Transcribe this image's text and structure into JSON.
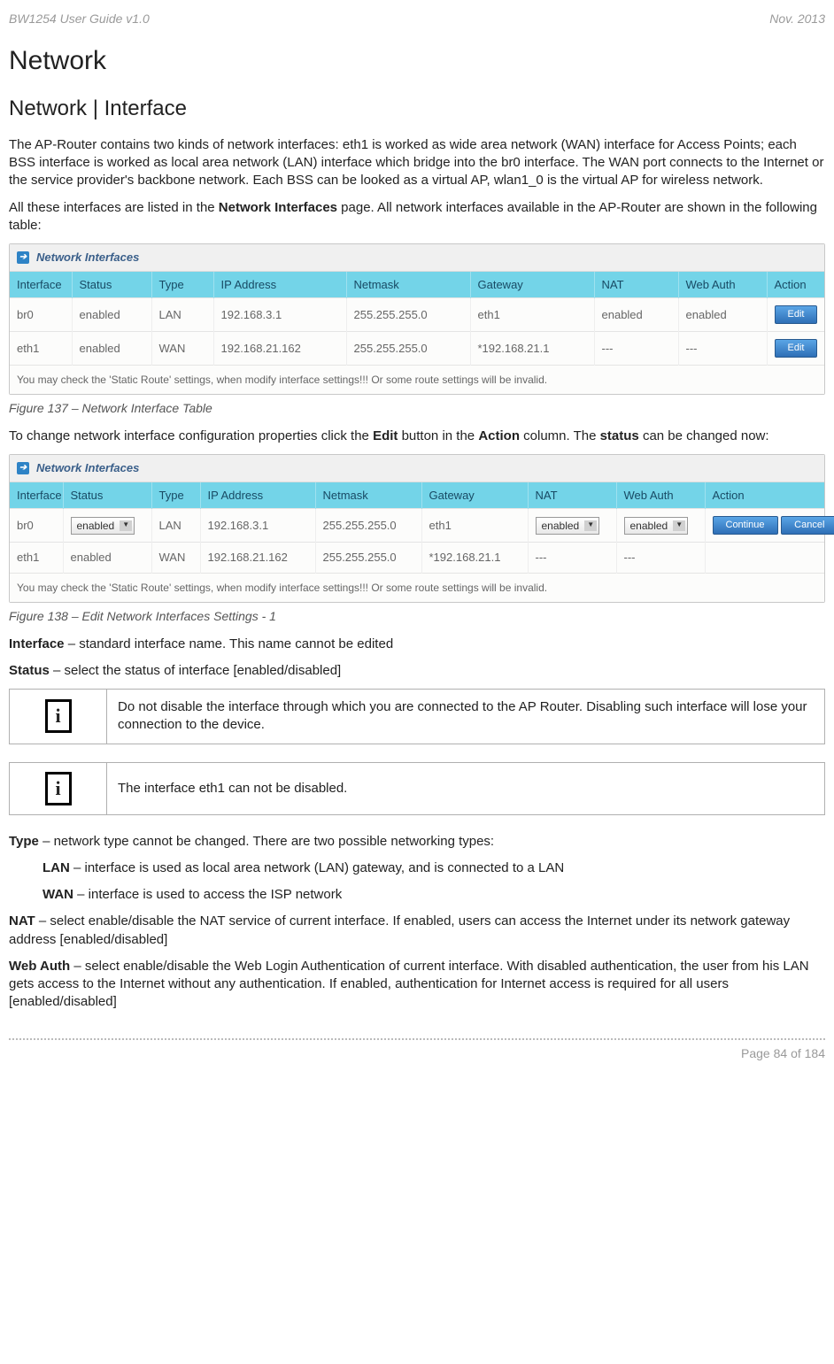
{
  "header": {
    "left": "BW1254 User Guide v1.0",
    "right": "Nov.  2013"
  },
  "h1": "Network",
  "h2": "Network | Interface",
  "para1": "The AP-Router contains two kinds of network interfaces: eth1 is worked as wide area network (WAN) interface for Access Points; each BSS interface is worked as local area network (LAN) interface which bridge into the br0 interface. The WAN port connects to the Internet or the service provider's backbone network. Each BSS can be looked as a virtual AP, wlan1_0 is the virtual AP for wireless network.",
  "para2_a": "All these interfaces are listed in the ",
  "para2_bold": "Network Interfaces",
  "para2_b": " page. All network interfaces available in the AP-Router are shown in the following table:",
  "panel1": {
    "title": "Network Interfaces",
    "cols": [
      "Interface",
      "Status",
      "Type",
      "IP Address",
      "Netmask",
      "Gateway",
      "NAT",
      "Web Auth",
      "Action"
    ],
    "rows": [
      {
        "cells": [
          "br0",
          "enabled",
          "LAN",
          "192.168.3.1",
          "255.255.255.0",
          "eth1",
          "enabled",
          "enabled"
        ],
        "action": "Edit"
      },
      {
        "cells": [
          "eth1",
          "enabled",
          "WAN",
          "192.168.21.162",
          "255.255.255.0",
          "*192.168.21.1",
          "---",
          "---"
        ],
        "action": "Edit"
      }
    ],
    "footnote": "You may check the 'Static Route' settings, when modify interface settings!!! Or some route settings will be invalid."
  },
  "caption1": "Figure 137 – Network Interface Table",
  "para3_a": "To change network interface configuration properties click the ",
  "para3_b1": "Edit",
  "para3_mid": " button in the ",
  "para3_b2": "Action",
  "para3_c": " column. The ",
  "para3_b3": "status",
  "para3_d": " can be changed now:",
  "panel2": {
    "title": "Network Interfaces",
    "cols": [
      "Interface",
      "Status",
      "Type",
      "IP Address",
      "Netmask",
      "Gateway",
      "NAT",
      "Web Auth",
      "Action"
    ],
    "rows": [
      {
        "cells": [
          "br0",
          "",
          "LAN",
          "192.168.3.1",
          "255.255.255.0",
          "eth1",
          "",
          ""
        ],
        "status_dd": "enabled",
        "nat_dd": "enabled",
        "web_dd": "enabled",
        "actions": [
          "Continue",
          "Cancel"
        ]
      },
      {
        "cells": [
          "eth1",
          "enabled",
          "WAN",
          "192.168.21.162",
          "255.255.255.0",
          "*192.168.21.1",
          "---",
          "---"
        ],
        "actions": []
      }
    ],
    "footnote": "You may check the 'Static Route' settings, when modify interface settings!!! Or some route settings will be invalid."
  },
  "caption2": "Figure 138 – Edit Network Interfaces Settings - 1",
  "defs": {
    "interface_b": "Interface",
    "interface_t": " – standard interface name. This name cannot be edited",
    "status_b": "Status",
    "status_t": " – select the status of interface [enabled/disabled]",
    "info1": "Do not disable the interface through which you are connected to the AP Router. Disabling such interface will lose your connection to the device.",
    "info2": "The interface eth1 can not be disabled.",
    "type_b": "Type",
    "type_t": " – network type cannot be changed. There are two possible networking types:",
    "lan_b": "LAN",
    "lan_t": " – interface is used as local area network (LAN) gateway, and is connected to a LAN",
    "wan_b": "WAN",
    "wan_t": " – interface is used to access the ISP network",
    "nat_b": "NAT",
    "nat_t": " – select enable/disable the NAT service of current interface. If enabled, users can access the Internet under its network gateway address [enabled/disabled]",
    "webauth_b": "Web Auth",
    "webauth_t": " – select enable/disable the Web Login Authentication of current interface. With disabled authentication, the user from his LAN gets access to the Internet without any authentication. If enabled, authentication for Internet access is required for all users [enabled/disabled]"
  },
  "footer": "Page 84 of 184",
  "info_icon": "i"
}
